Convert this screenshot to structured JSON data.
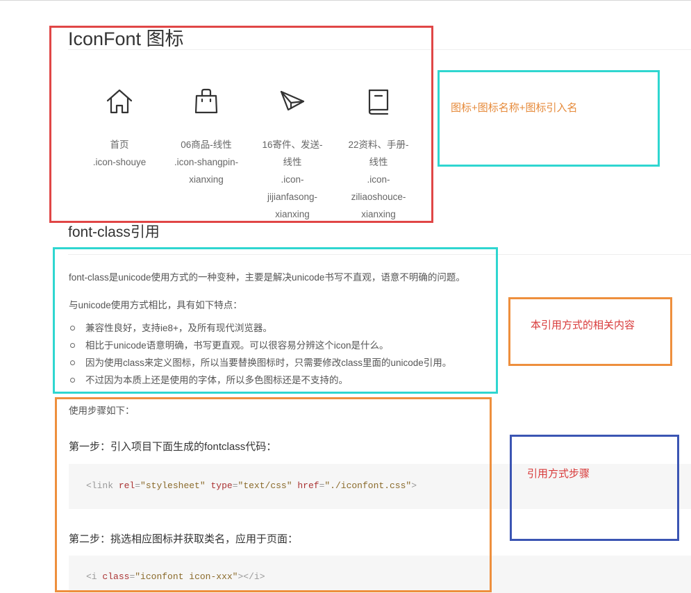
{
  "page": {
    "title": "IconFont 图标"
  },
  "icons": [
    {
      "icon": "home-icon",
      "name": "首页",
      "ref_lines": [
        ".icon-shouye"
      ]
    },
    {
      "icon": "shopping-bag-icon",
      "name_lines": [
        "06商品-线性"
      ],
      "ref_lines": [
        ".icon-shangpin-",
        "xianxing"
      ]
    },
    {
      "icon": "paper-plane-icon",
      "name_lines": [
        "16寄件、发送-",
        "线性"
      ],
      "ref_lines": [
        ".icon-",
        "jijianfasong-",
        "xianxing"
      ]
    },
    {
      "icon": "book-icon",
      "name_lines": [
        "22资料、手册-",
        "线性"
      ],
      "ref_lines": [
        ".icon-",
        "ziliaoshouce-",
        "xianxing"
      ]
    }
  ],
  "font_class": {
    "title": "font-class引用",
    "intro": "font-class是unicode使用方式的一种变种，主要是解决unicode书写不直观，语意不明确的问题。",
    "compare": "与unicode使用方式相比，具有如下特点：",
    "features": [
      "兼容性良好，支持ie8+，及所有现代浏览器。",
      "相比于unicode语意明确，书写更直观。可以很容易分辨这个icon是什么。",
      "因为使用class来定义图标，所以当要替换图标时，只需要修改class里面的unicode引用。",
      "不过因为本质上还是使用的字体，所以多色图标还是不支持的。"
    ],
    "steps_intro": "使用步骤如下：",
    "step1": "第一步：引入项目下面生成的fontclass代码：",
    "code1": {
      "open": "<link",
      "attr1": "rel",
      "val1": "\"stylesheet\"",
      "attr2": "type",
      "val2": "\"text/css\"",
      "attr3": "href",
      "val3": "\"./iconfont.css\"",
      "close": ">"
    },
    "step2": "第二步：挑选相应图标并获取类名，应用于页面：",
    "code2": {
      "open": "<i",
      "attr1": "class",
      "val1": "\"iconfont icon-xxx\"",
      "close": "></i>"
    }
  },
  "annotations": {
    "icon_info": "图标+图标名称+图标引入名",
    "related_content": "本引用方式的相关内容",
    "usage_steps": "引用方式步骤"
  },
  "colors": {
    "red_frame": "#e04646",
    "cyan_frame": "#2fd6d0",
    "orange_frame": "#ee8f3d",
    "blue_frame": "#3b55b3",
    "orange_note": "#e68a3a",
    "red_note": "#d83a3a"
  }
}
